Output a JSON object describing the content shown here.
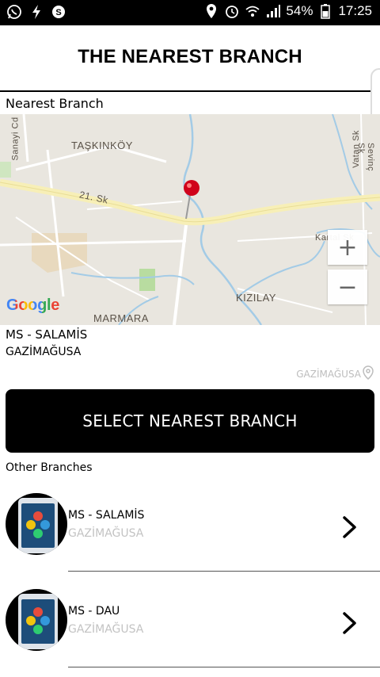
{
  "status_bar": {
    "battery": "54%",
    "time": "17:25",
    "icons": [
      "whatsapp-icon",
      "flash-icon",
      "skype-icon",
      "location-icon",
      "alarm-icon",
      "wifi-icon",
      "signal-icon",
      "battery-icon"
    ]
  },
  "header": {
    "title": "THE NEAREST BRANCH"
  },
  "nearest_section": {
    "label": "Nearest Branch",
    "map": {
      "labels": {
        "district_1": "TAŞKINKÖY",
        "district_2": "KIZILAY",
        "district_3": "MARMARA",
        "street_1": "21. Sk",
        "street_2": "Sanayi Cd",
        "street_3": "Vatan Sk",
        "street_4": "Sevinç Sk",
        "street_5": "Kartal Sk"
      },
      "logo": "Google",
      "zoom_in": "+",
      "zoom_out": "−",
      "pin_color": "#d0021b"
    },
    "branch_name": "MS - SALAMİS",
    "branch_city": "GAZİMAĞUSA",
    "location_text": "GAZİMAĞUSA"
  },
  "select_button": {
    "label": "SELECT NEAREST BRANCH"
  },
  "other_section": {
    "label": "Other Branches"
  },
  "branches": [
    {
      "name": "MS - SALAMİS",
      "city": "GAZİMAĞUSA"
    },
    {
      "name": "MS - DAU",
      "city": "GAZİMAĞUSA"
    }
  ],
  "colors": {
    "accent": "#000000",
    "muted_text": "#c3c3c3",
    "map_bg": "#e9e6df",
    "road": "#f7efb7",
    "water": "#a3cbe6"
  }
}
